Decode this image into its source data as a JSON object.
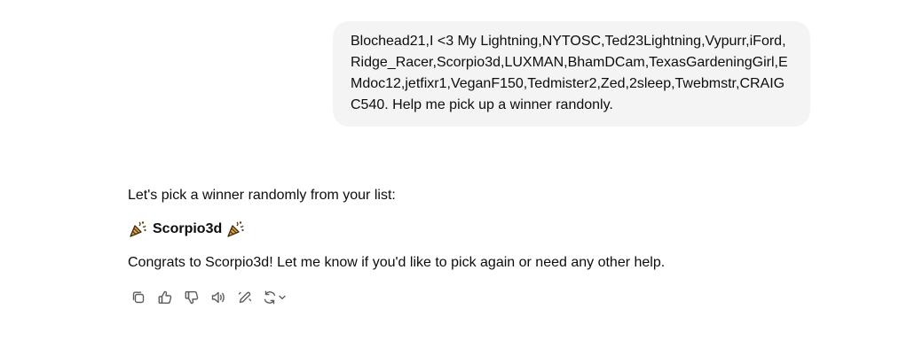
{
  "user_message": {
    "text": "Blochead21,I <3 My Lightning,NYTOSC,Ted23Lightning,Vypurr,iFord,Ridge_Racer,Scorpio3d,LUXMAN,BhamDCam,TexasGardeningGirl,EMdoc12,jetfixr1,VeganF150,Tedmister2,Zed,2sleep,Twebmstr,CRAIGC540. Help me pick up a winner randonly."
  },
  "assistant_message": {
    "intro": "Let's pick a winner randomly from your list:",
    "winner": "Scorpio3d",
    "winner_emoji_left": "party-popper",
    "winner_emoji_right": "party-popper",
    "closing": "Congrats to Scorpio3d! Let me know if you'd like to pick again or need any other help."
  },
  "actions": [
    {
      "name": "copy-icon"
    },
    {
      "name": "thumbs-up-icon"
    },
    {
      "name": "thumbs-down-icon"
    },
    {
      "name": "read-aloud-icon"
    },
    {
      "name": "edit-icon"
    },
    {
      "name": "regenerate-icon"
    }
  ],
  "colors": {
    "user_bubble_bg": "#f4f4f4",
    "text": "#0d0d0d",
    "icon": "#5d5d5d",
    "popper_body": "#e8a33c",
    "confetti": "#5b3a1a"
  }
}
